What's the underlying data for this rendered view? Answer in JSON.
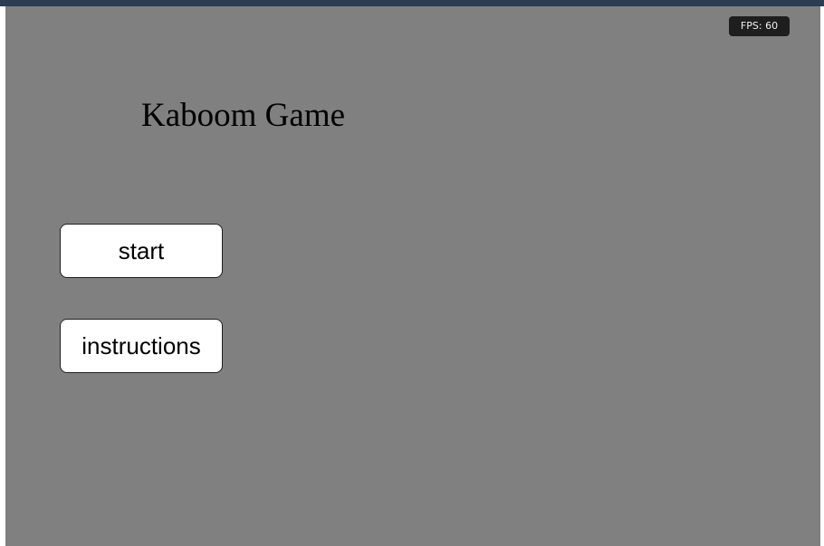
{
  "overlay": {
    "fps_label": "FPS: 60"
  },
  "menu": {
    "title": "Kaboom Game",
    "buttons": [
      {
        "label": "start"
      },
      {
        "label": "instructions"
      }
    ]
  },
  "colors": {
    "canvas_background": "#808080",
    "top_bar": "#2e3c52",
    "button_fill": "#ffffff",
    "fps_badge": "#1e1e1e"
  }
}
